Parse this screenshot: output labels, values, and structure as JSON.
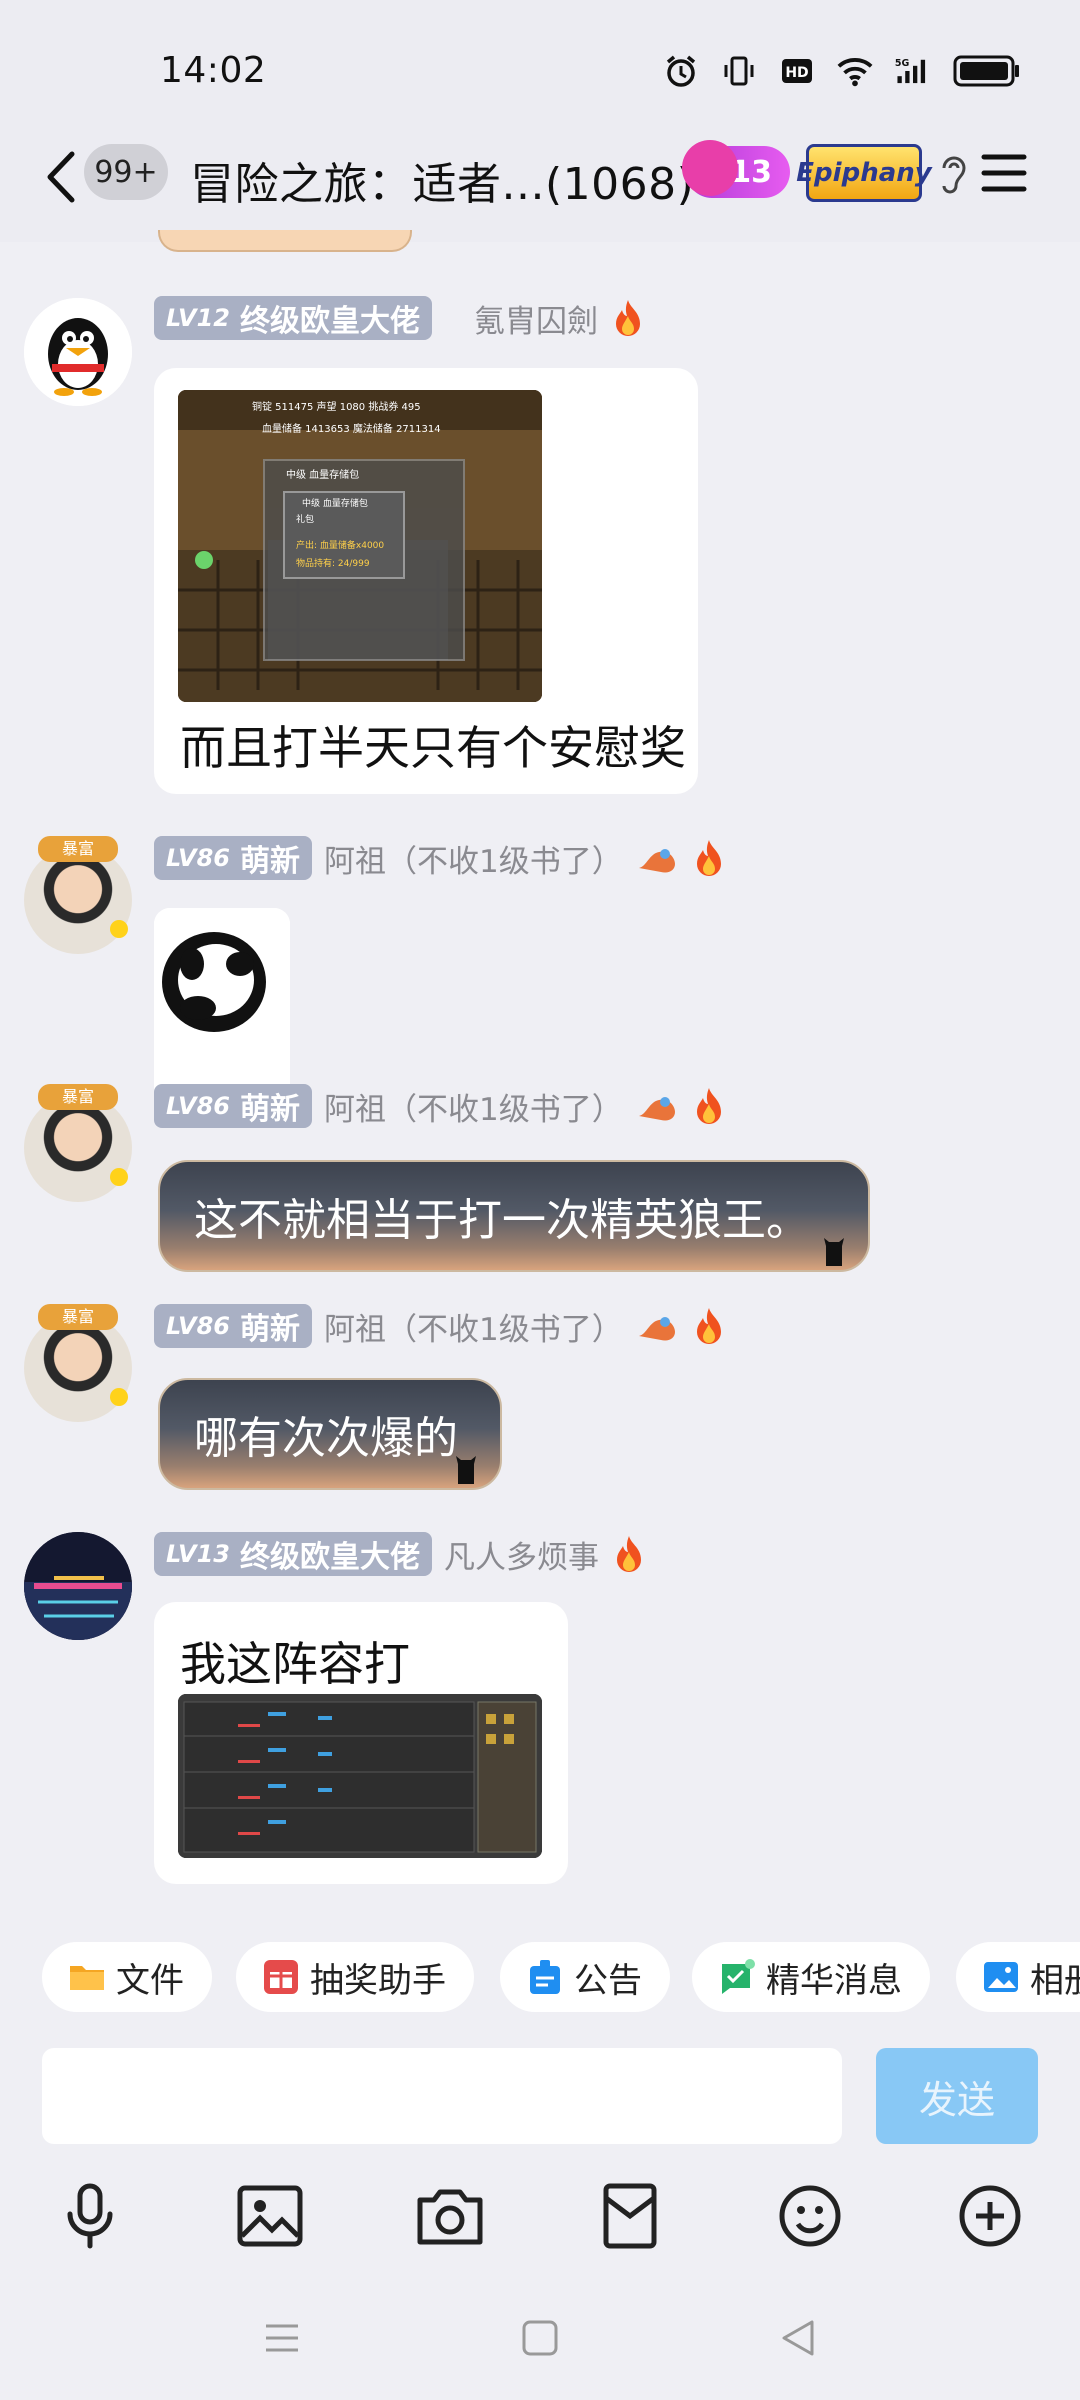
{
  "status": {
    "time": "14:02"
  },
  "nav": {
    "unread_badge": "99+",
    "title": "冒险之旅：适者...(1068)",
    "flame_count": "13",
    "epiphany_label": "Epiphany"
  },
  "messages": [
    {
      "level": "LV12",
      "title": "终级欧皇大佬",
      "nickname": "氪胄囚劍",
      "text": "而且打半天只有个安慰奖",
      "game_caption": [
        "铜锭 511475  声望 1080  挑战券 495",
        "血量储备 1413653  魔法储备 2711314",
        "中级 血量存储包",
        "中级 血量存储包",
        "礼包",
        "产出: 血量储备x4000",
        "物品持有: 24/999"
      ]
    },
    {
      "level": "LV86",
      "title": "萌新",
      "nickname": "阿祖（不收1级书了）"
    },
    {
      "level": "LV86",
      "title": "萌新",
      "nickname": "阿祖（不收1级书了）",
      "text": "这不就相当于打一次精英狼王。"
    },
    {
      "level": "LV86",
      "title": "萌新",
      "nickname": "阿祖（不收1级书了）",
      "text": "哪有次次爆的"
    },
    {
      "level": "LV13",
      "title": "终级欧皇大佬",
      "nickname": "凡人多烦事",
      "text": "我这阵容打"
    }
  ],
  "chips": [
    "文件",
    "抽奖助手",
    "公告",
    "精华消息",
    "相册"
  ],
  "input": {
    "send_label": "发送"
  },
  "colors": {
    "accent_send": "#88c8f5",
    "level_tag": "#a9b0c4",
    "chat_bg": "#efeff4"
  }
}
